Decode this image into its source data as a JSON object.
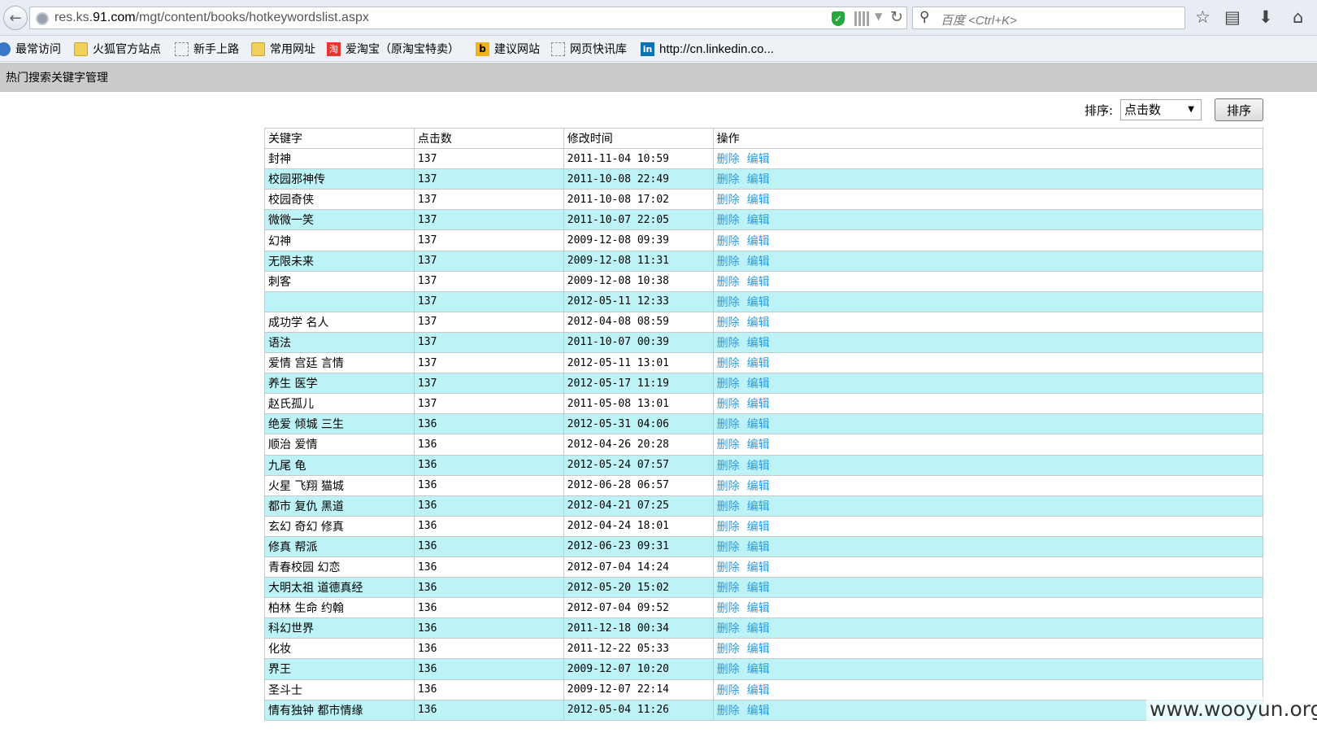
{
  "browser": {
    "url_prefix": "res.ks.",
    "url_domain": "91.com",
    "url_path": "/mgt/content/books/hotkeywordslist.aspx",
    "search_placeholder": "百度 <Ctrl+K>"
  },
  "bookmarks": [
    {
      "label": "最常访问",
      "icon": "frequent-icon"
    },
    {
      "label": "火狐官方站点",
      "icon": "folder-icon"
    },
    {
      "label": "新手上路",
      "icon": "page-icon"
    },
    {
      "label": "常用网址",
      "icon": "folder-icon"
    },
    {
      "label": "爱淘宝（原淘宝特卖）",
      "icon": "taobao-icon"
    },
    {
      "label": "建议网站",
      "icon": "bing-icon"
    },
    {
      "label": "网页快讯库",
      "icon": "page-icon"
    },
    {
      "label": "http://cn.linkedin.co...",
      "icon": "linkedin-icon"
    }
  ],
  "page": {
    "title": "热门搜索关键字管理",
    "sort_label": "排序:",
    "sort_value": "点击数",
    "sort_button": "排序"
  },
  "table": {
    "headers": [
      "关键字",
      "点击数",
      "修改时间",
      "操作"
    ],
    "delete_label": "删除",
    "edit_label": "编辑",
    "rows": [
      {
        "keyword": "封神",
        "clicks": "137",
        "time": "2011-11-04 10:59"
      },
      {
        "keyword": "校园邪神传",
        "clicks": "137",
        "time": "2011-10-08 22:49"
      },
      {
        "keyword": "校园奇侠",
        "clicks": "137",
        "time": "2011-10-08 17:02"
      },
      {
        "keyword": "微微一笑",
        "clicks": "137",
        "time": "2011-10-07 22:05"
      },
      {
        "keyword": "幻神",
        "clicks": "137",
        "time": "2009-12-08 09:39"
      },
      {
        "keyword": "无限未来",
        "clicks": "137",
        "time": "2009-12-08 11:31"
      },
      {
        "keyword": "刺客",
        "clicks": "137",
        "time": "2009-12-08 10:38"
      },
      {
        "keyword": "",
        "clicks": "137",
        "time": "2012-05-11 12:33"
      },
      {
        "keyword": "成功学 名人",
        "clicks": "137",
        "time": "2012-04-08 08:59"
      },
      {
        "keyword": "语法",
        "clicks": "137",
        "time": "2011-10-07 00:39"
      },
      {
        "keyword": "爱情 宫廷 言情",
        "clicks": "137",
        "time": "2012-05-11 13:01"
      },
      {
        "keyword": "养生 医学",
        "clicks": "137",
        "time": "2012-05-17 11:19"
      },
      {
        "keyword": "赵氏孤儿",
        "clicks": "137",
        "time": "2011-05-08 13:01"
      },
      {
        "keyword": "绝爱 倾城 三生",
        "clicks": "136",
        "time": "2012-05-31 04:06"
      },
      {
        "keyword": "顺治 爱情",
        "clicks": "136",
        "time": "2012-04-26 20:28"
      },
      {
        "keyword": "九尾 龟",
        "clicks": "136",
        "time": "2012-05-24 07:57"
      },
      {
        "keyword": "火星 飞翔 猫城",
        "clicks": "136",
        "time": "2012-06-28 06:57"
      },
      {
        "keyword": "都市 复仇 黑道",
        "clicks": "136",
        "time": "2012-04-21 07:25"
      },
      {
        "keyword": "玄幻 奇幻 修真",
        "clicks": "136",
        "time": "2012-04-24 18:01"
      },
      {
        "keyword": "修真 帮派",
        "clicks": "136",
        "time": "2012-06-23 09:31"
      },
      {
        "keyword": "青春校园 幻恋",
        "clicks": "136",
        "time": "2012-07-04 14:24"
      },
      {
        "keyword": "大明太祖 道德真经",
        "clicks": "136",
        "time": "2012-05-20 15:02"
      },
      {
        "keyword": "柏林 生命 约翰",
        "clicks": "136",
        "time": "2012-07-04 09:52"
      },
      {
        "keyword": "科幻世界",
        "clicks": "136",
        "time": "2011-12-18 00:34"
      },
      {
        "keyword": "化妆",
        "clicks": "136",
        "time": "2011-12-22 05:33"
      },
      {
        "keyword": "界王",
        "clicks": "136",
        "time": "2009-12-07 10:20"
      },
      {
        "keyword": "圣斗士",
        "clicks": "136",
        "time": "2009-12-07 22:14"
      },
      {
        "keyword": "情有独钟 都市情缘",
        "clicks": "136",
        "time": "2012-05-04 11:26"
      }
    ]
  },
  "watermark": "www.wooyun.org"
}
